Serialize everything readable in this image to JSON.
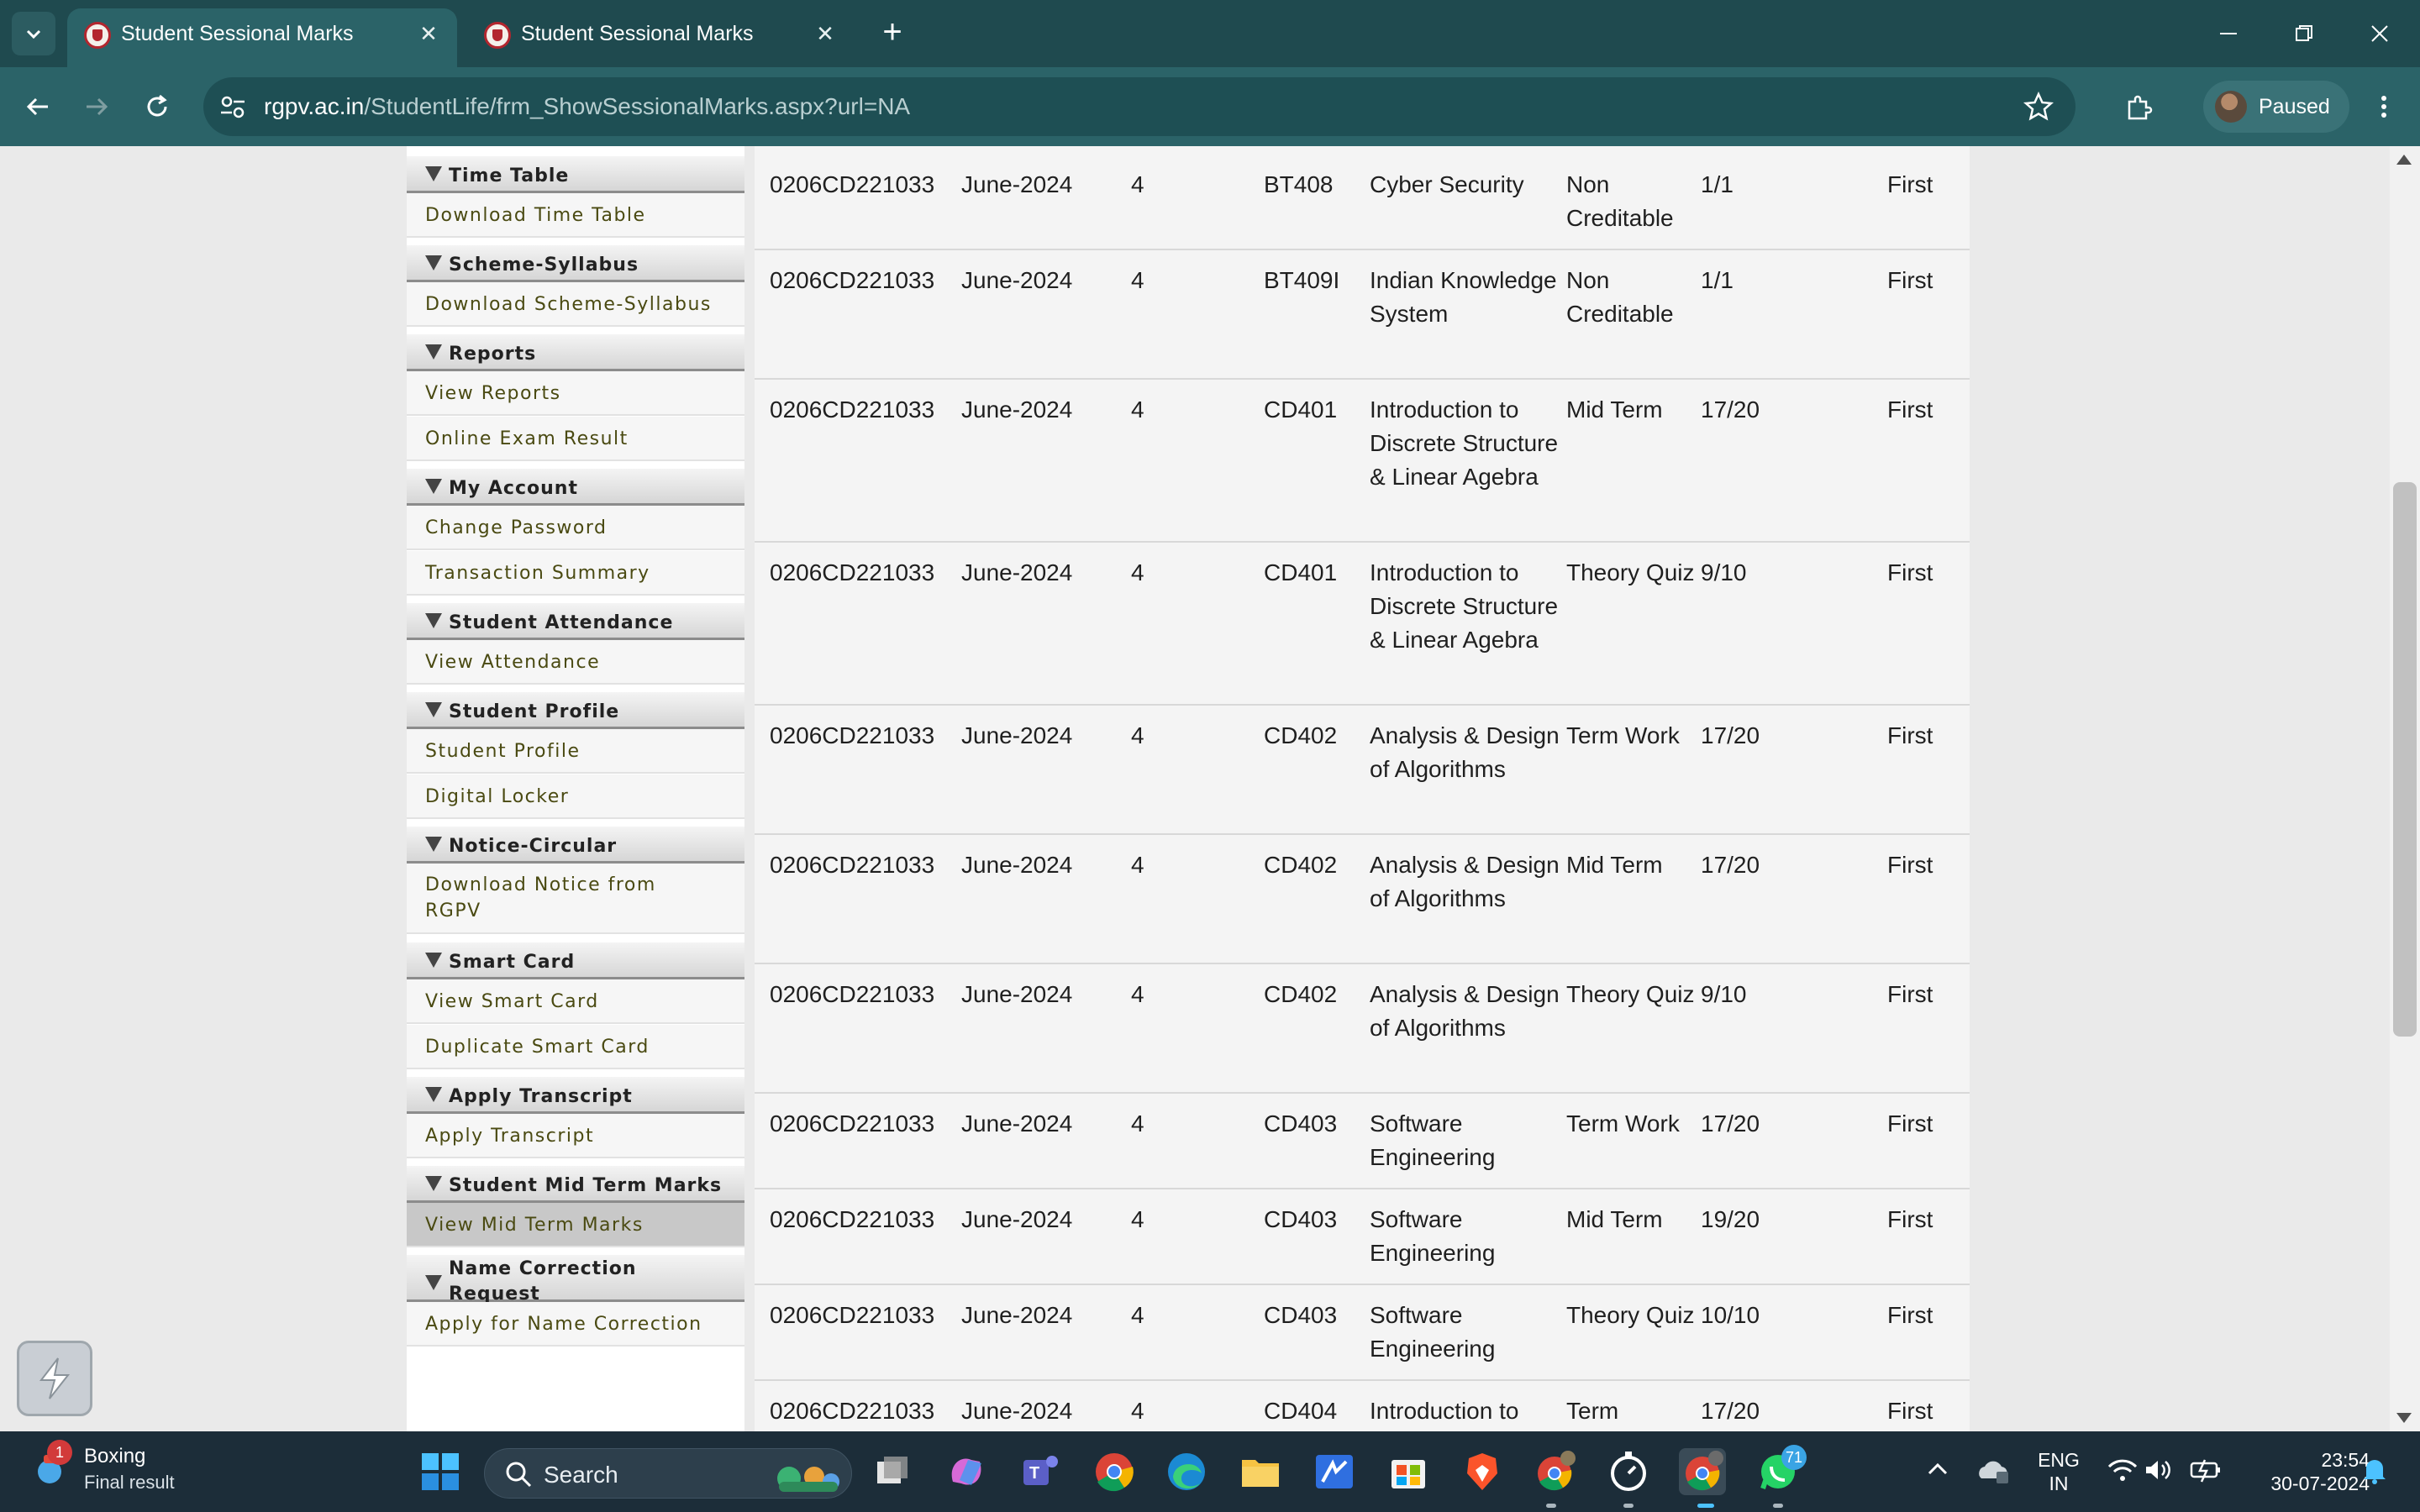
{
  "browser": {
    "tabs": [
      {
        "title": "Student Sessional Marks",
        "active": true
      },
      {
        "title": "Student Sessional Marks",
        "active": false
      }
    ],
    "new_tab_label": "+",
    "close_glyph": "✕",
    "url_domain": "rgpv.ac.in",
    "url_path": "/StudentLife/frm_ShowSessionalMarks.aspx?url=NA",
    "profile_status": "Paused"
  },
  "sidebar": {
    "sections": [
      {
        "title": "Time Table",
        "items": [
          {
            "label": "Download Time Table"
          }
        ]
      },
      {
        "title": "Scheme-Syllabus",
        "items": [
          {
            "label": "Download Scheme-Syllabus"
          }
        ]
      },
      {
        "title": "Reports",
        "items": [
          {
            "label": "View Reports"
          },
          {
            "label": "Online Exam Result"
          }
        ]
      },
      {
        "title": "My Account",
        "items": [
          {
            "label": "Change Password"
          },
          {
            "label": "Transaction Summary"
          }
        ]
      },
      {
        "title": "Student Attendance",
        "items": [
          {
            "label": "View Attendance"
          }
        ]
      },
      {
        "title": "Student Profile",
        "items": [
          {
            "label": "Student Profile"
          },
          {
            "label": "Digital Locker"
          }
        ]
      },
      {
        "title": "Notice-Circular",
        "items": [
          {
            "label": "Download Notice from RGPV"
          }
        ]
      },
      {
        "title": "Smart Card",
        "items": [
          {
            "label": "View Smart Card"
          },
          {
            "label": "Duplicate Smart Card"
          }
        ]
      },
      {
        "title": "Apply Transcript",
        "items": [
          {
            "label": "Apply Transcript"
          }
        ]
      },
      {
        "title": "Student Mid Term Marks",
        "items": [
          {
            "label": "View Mid Term Marks",
            "selected": true
          }
        ]
      },
      {
        "title": "Name Correction Request",
        "items": [
          {
            "label": "Apply for Name Correction"
          }
        ]
      }
    ]
  },
  "marks_table": {
    "rows": [
      {
        "roll": "0206CD221033",
        "session": "June-2024",
        "sem": "4",
        "code": "BT408",
        "subject": "Cyber Security",
        "type": "Non Creditable",
        "marks": "1/1",
        "attempt": "First"
      },
      {
        "roll": "0206CD221033",
        "session": "June-2024",
        "sem": "4",
        "code": "BT409I",
        "subject": "Indian Knowledge System",
        "type": "Non Creditable",
        "marks": "1/1",
        "attempt": "First"
      },
      {
        "roll": "0206CD221033",
        "session": "June-2024",
        "sem": "4",
        "code": "CD401",
        "subject": "Introduction to Discrete Structure & Linear Agebra",
        "type": "Mid Term",
        "marks": "17/20",
        "attempt": "First"
      },
      {
        "roll": "0206CD221033",
        "session": "June-2024",
        "sem": "4",
        "code": "CD401",
        "subject": "Introduction to Discrete Structure & Linear Agebra",
        "type": "Theory Quiz",
        "marks": "9/10",
        "attempt": "First"
      },
      {
        "roll": "0206CD221033",
        "session": "June-2024",
        "sem": "4",
        "code": "CD402",
        "subject": "Analysis & Design of Algorithms",
        "type": "Term Work",
        "marks": "17/20",
        "attempt": "First"
      },
      {
        "roll": "0206CD221033",
        "session": "June-2024",
        "sem": "4",
        "code": "CD402",
        "subject": "Analysis & Design of Algorithms",
        "type": "Mid Term",
        "marks": "17/20",
        "attempt": "First"
      },
      {
        "roll": "0206CD221033",
        "session": "June-2024",
        "sem": "4",
        "code": "CD402",
        "subject": "Analysis & Design of Algorithms",
        "type": "Theory Quiz",
        "marks": "9/10",
        "attempt": "First"
      },
      {
        "roll": "0206CD221033",
        "session": "June-2024",
        "sem": "4",
        "code": "CD403",
        "subject": "Software Engineering",
        "type": "Term Work",
        "marks": "17/20",
        "attempt": "First"
      },
      {
        "roll": "0206CD221033",
        "session": "June-2024",
        "sem": "4",
        "code": "CD403",
        "subject": "Software Engineering",
        "type": "Mid Term",
        "marks": "19/20",
        "attempt": "First"
      },
      {
        "roll": "0206CD221033",
        "session": "June-2024",
        "sem": "4",
        "code": "CD403",
        "subject": "Software Engineering",
        "type": "Theory Quiz",
        "marks": "10/10",
        "attempt": "First"
      },
      {
        "roll": "0206CD221033",
        "session": "June-2024",
        "sem": "4",
        "code": "CD404",
        "subject": "Introduction to",
        "type": "Term",
        "marks": "17/20",
        "attempt": "First"
      }
    ]
  },
  "taskbar": {
    "weather_title": "Boxing",
    "weather_subtitle": "Final result",
    "weather_badge": "1",
    "search_label": "Search",
    "whatsapp_badge": "71",
    "language_line1": "ENG",
    "language_line2": "IN",
    "time": "23:54",
    "date": "30-07-2024"
  },
  "colors": {
    "chrome_dark": "#1f4a4f",
    "chrome_toolbar": "#2b6368",
    "sidebar_link": "#4a4a12",
    "taskbar": "#1c2d39"
  }
}
